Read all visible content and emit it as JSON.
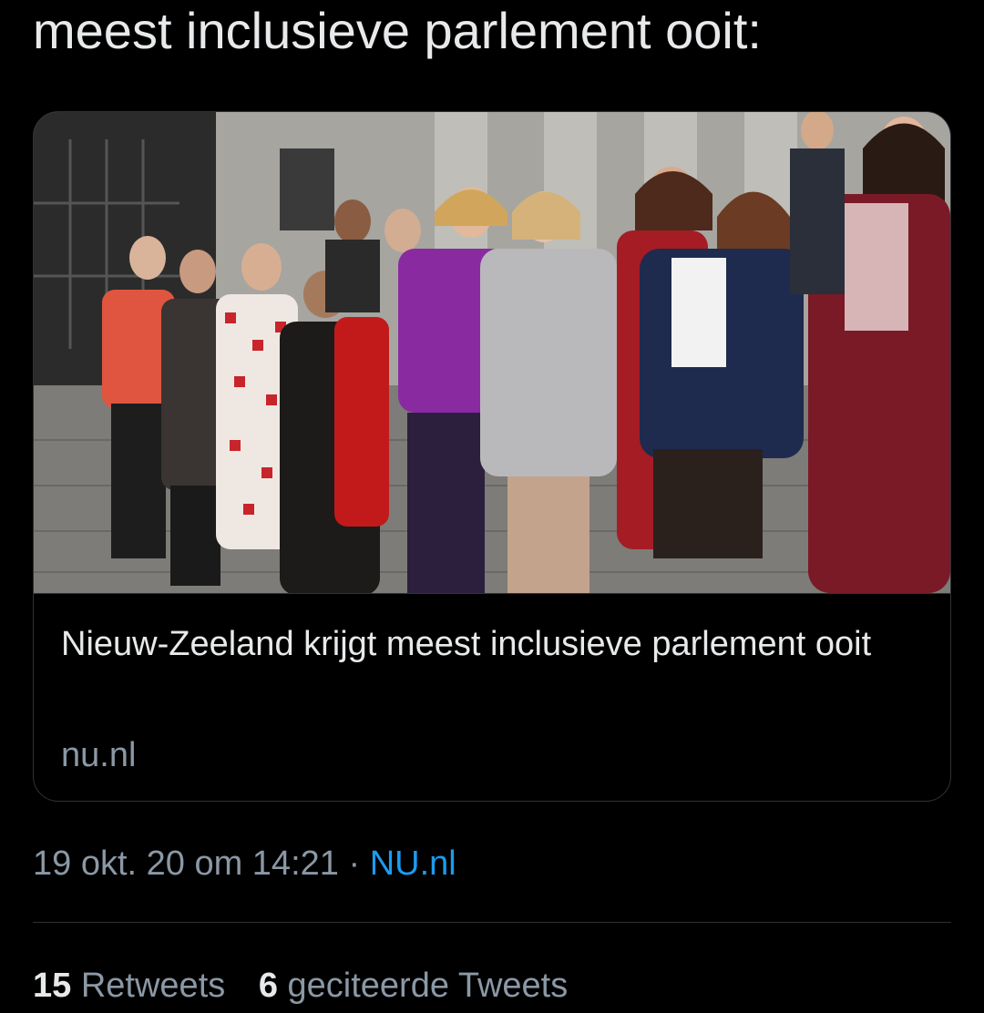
{
  "tweet": {
    "text": "meest inclusieve parlement ooit:"
  },
  "card": {
    "image_alt": "photo-group-on-parliament-steps",
    "title": "Nieuw-Zeeland krijgt meest inclusieve parlement ooit",
    "domain": "nu.nl"
  },
  "meta": {
    "timestamp": "19 okt. 20 om 14:21",
    "separator": " · ",
    "source": "NU.nl"
  },
  "stats": {
    "retweets_count": "15",
    "retweets_label": "Retweets",
    "quotes_count": "6",
    "quotes_label": "geciteerde Tweets"
  },
  "colors": {
    "background": "#000000",
    "text_primary": "#e7e9ea",
    "text_secondary": "#8b98a5",
    "link": "#1d9bf0",
    "border": "#2f3336"
  }
}
